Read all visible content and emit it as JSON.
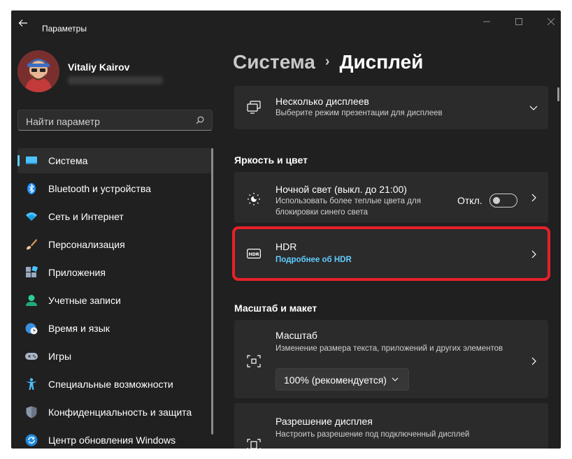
{
  "window": {
    "title": "Параметры"
  },
  "user": {
    "name": "Vitaliy Kairov"
  },
  "search": {
    "placeholder": "Найти параметр"
  },
  "sidebar": {
    "items": [
      {
        "label": "Система",
        "icon": "display-icon",
        "active": true
      },
      {
        "label": "Bluetooth и устройства",
        "icon": "bluetooth-icon"
      },
      {
        "label": "Сеть и Интернет",
        "icon": "wifi-icon"
      },
      {
        "label": "Персонализация",
        "icon": "brush-icon"
      },
      {
        "label": "Приложения",
        "icon": "apps-icon"
      },
      {
        "label": "Учетные записи",
        "icon": "account-icon"
      },
      {
        "label": "Время и язык",
        "icon": "globe-clock-icon"
      },
      {
        "label": "Игры",
        "icon": "gamepad-icon"
      },
      {
        "label": "Специальные возможности",
        "icon": "accessibility-icon"
      },
      {
        "label": "Конфиденциальность и защита",
        "icon": "shield-icon"
      },
      {
        "label": "Центр обновления Windows",
        "icon": "update-icon"
      }
    ]
  },
  "breadcrumb": {
    "parent": "Система",
    "separator": "›",
    "current": "Дисплей"
  },
  "cards": {
    "multi_display": {
      "title": "Несколько дисплеев",
      "subtitle": "Выберите режим презентации для дисплеев"
    },
    "brightness_section": "Яркость и цвет",
    "night_light": {
      "title": "Ночной свет (выкл. до 21:00)",
      "subtitle_line1": "Использовать более теплые цвета для",
      "subtitle_line2": "блокировки синего света",
      "state_label": "Откл.",
      "enabled": false
    },
    "hdr": {
      "title": "HDR",
      "link": "Подробнее об HDR"
    },
    "scale_section": "Масштаб и макет",
    "scale": {
      "title": "Масштаб",
      "subtitle": "Изменение размера текста, приложений и других элементов",
      "value": "100% (рекомендуется)"
    },
    "resolution": {
      "title": "Разрешение дисплея",
      "subtitle": "Настроить разрешение под подключенный дисплей"
    }
  },
  "colors": {
    "accent": "#60cdff",
    "highlight": "#e8202a",
    "background": "#202020",
    "card": "#2b2b2b"
  }
}
